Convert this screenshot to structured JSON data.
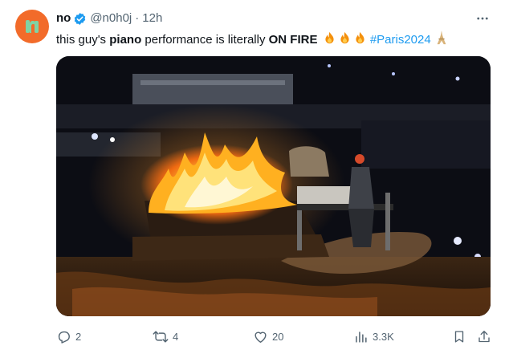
{
  "author": {
    "name": "no",
    "handle": "@n0h0j",
    "separator": "·",
    "time": "12h",
    "avatar_color": "#f26b2a",
    "verified_color": "#1d9bf0"
  },
  "tweet": {
    "text_1": "this guy's ",
    "text_bold_1": "piano",
    "text_2": " performance is literally ",
    "text_bold_2": "ON FIRE",
    "emojis": [
      "fire-emoji",
      "fire-emoji",
      "fire-emoji"
    ],
    "hashtag": "#Paris2024",
    "trailing_emoji": "eiffel-tower-emoji"
  },
  "media": {
    "description_icon": "video-still"
  },
  "actions": {
    "reply_count": "2",
    "retweet_count": "4",
    "like_count": "20",
    "views_count": "3.3K"
  },
  "colors": {
    "text": "#0f1419",
    "muted": "#536471",
    "link": "#1d9bf0"
  }
}
